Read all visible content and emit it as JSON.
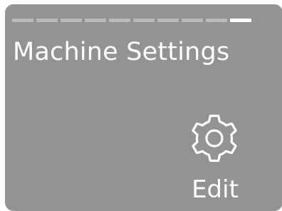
{
  "screen": {
    "title": "Machine Settings",
    "background_color": "#929395",
    "page_indicator": {
      "total_pages": 10,
      "current_page": 10
    },
    "edit_button": {
      "icon": "gear-icon",
      "label": "Edit"
    }
  }
}
